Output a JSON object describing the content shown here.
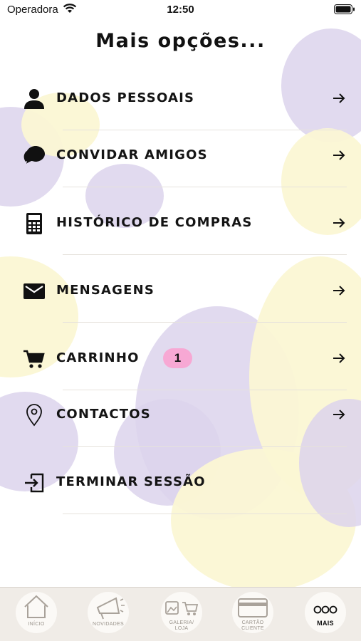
{
  "status_bar": {
    "carrier": "Operadora",
    "time": "12:50"
  },
  "page": {
    "title": "Mais opções..."
  },
  "menu": [
    {
      "label": "DADOS PESSOAIS",
      "icon": "person-icon"
    },
    {
      "label": "CONVIDAR AMIGOS",
      "icon": "chat-bubbles-icon"
    },
    {
      "label": "HISTÓRICO DE COMPRAS",
      "icon": "calculator-icon"
    },
    {
      "label": "MENSAGENS",
      "icon": "envelope-icon"
    },
    {
      "label": "CARRINHO",
      "icon": "cart-icon",
      "badge": "1"
    },
    {
      "label": "CONTACTOS",
      "icon": "location-pin-icon"
    },
    {
      "label": "TERMINAR SESSÃO",
      "icon": "logout-icon"
    }
  ],
  "tab_bar": {
    "tabs": [
      {
        "label": "INÍCIO",
        "icon": "home-icon"
      },
      {
        "label": "NOVIDADES",
        "icon": "megaphone-icon"
      },
      {
        "label": "GALERIA/\nLOJA",
        "icon": "gallery-cart-icon"
      },
      {
        "label": "CARTÃO\nCLIENTE",
        "icon": "card-icon"
      },
      {
        "label": "MAIS",
        "icon": "more-dots-icon",
        "active": true
      }
    ]
  },
  "colors": {
    "badge": "#f7a8d4",
    "background_lavender": "#dcd3ec",
    "background_yellow": "#fbf7d4"
  }
}
